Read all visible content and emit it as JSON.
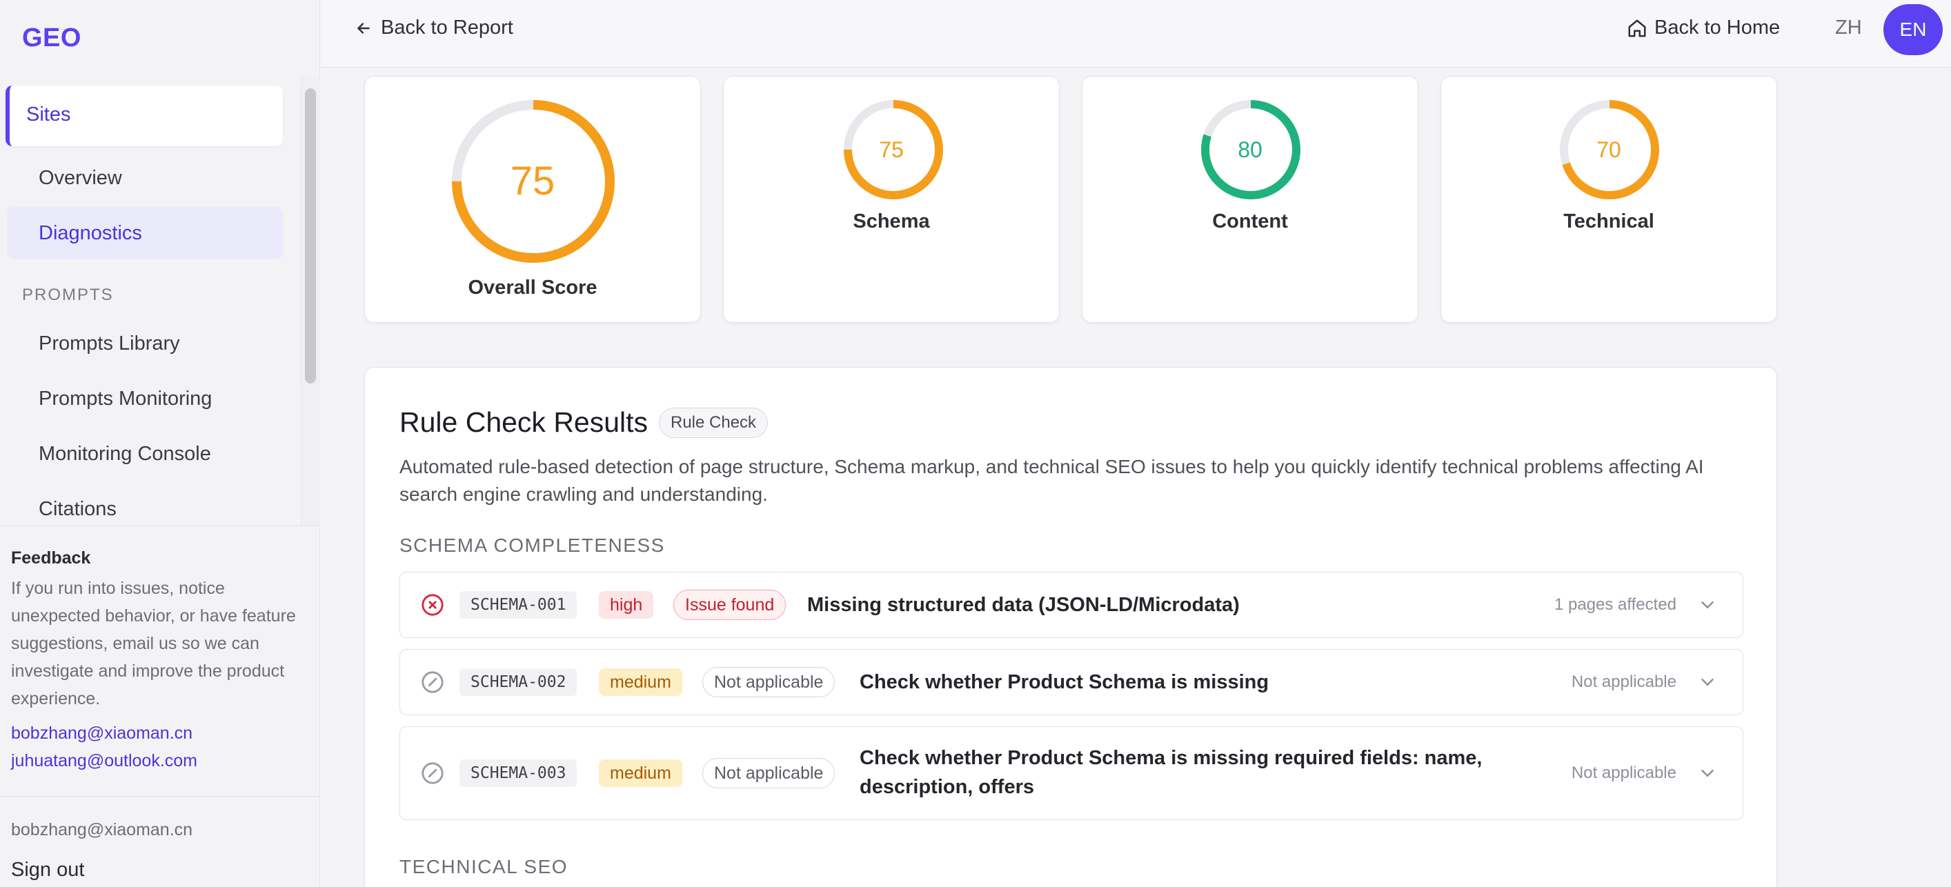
{
  "app": {
    "logo": "GEO"
  },
  "sidebar": {
    "active_item": "Sites",
    "items": [
      {
        "label": "Overview"
      },
      {
        "label": "Diagnostics"
      }
    ],
    "section_prompts": "PROMPTS",
    "prompt_items": [
      {
        "label": "Prompts Library"
      },
      {
        "label": "Prompts Monitoring"
      },
      {
        "label": "Monitoring Console"
      },
      {
        "label": "Citations"
      }
    ],
    "feedback": {
      "title": "Feedback",
      "text": "If you run into issues, notice unexpected behavior, or have feature suggestions, email us so we can investigate and improve the product experience.",
      "email1": "bobzhang@xiaoman.cn",
      "email2": "juhuatang@outlook.com"
    },
    "account": {
      "email": "bobzhang@xiaoman.cn",
      "signout": "Sign out"
    }
  },
  "topbar": {
    "back_report": "Back to Report",
    "back_home": "Back to Home",
    "lang_zh": "ZH",
    "lang_en": "EN"
  },
  "scores": [
    {
      "label": "Overall Score",
      "value": "75",
      "fraction": 0.75,
      "color": "#f59e1b"
    },
    {
      "label": "Schema",
      "value": "75",
      "fraction": 0.75,
      "color": "#f59e1b"
    },
    {
      "label": "Content",
      "value": "80",
      "fraction": 0.8,
      "color": "#1fb27c"
    },
    {
      "label": "Technical",
      "value": "70",
      "fraction": 0.7,
      "color": "#f59e1b"
    }
  ],
  "rule_check": {
    "title": "Rule Check Results",
    "badge": "Rule Check",
    "description": "Automated rule-based detection of page structure, Schema markup, and technical SEO issues to help you quickly identify technical problems affecting AI search engine crawling and understanding.",
    "section_schema": "SCHEMA COMPLETENESS",
    "section_technical": "TECHNICAL SEO",
    "rules": [
      {
        "code": "SCHEMA-001",
        "severity": "high",
        "status": "Issue found",
        "title": "Missing structured data (JSON-LD/Microdata)",
        "meta": "1 pages affected"
      },
      {
        "code": "SCHEMA-002",
        "severity": "medium",
        "status": "Not applicable",
        "title": "Check whether Product Schema is missing",
        "meta": "Not applicable"
      },
      {
        "code": "SCHEMA-003",
        "severity": "medium",
        "status": "Not applicable",
        "title": "Check whether Product Schema is missing required fields: name, description, offers",
        "meta": "Not applicable"
      }
    ]
  }
}
